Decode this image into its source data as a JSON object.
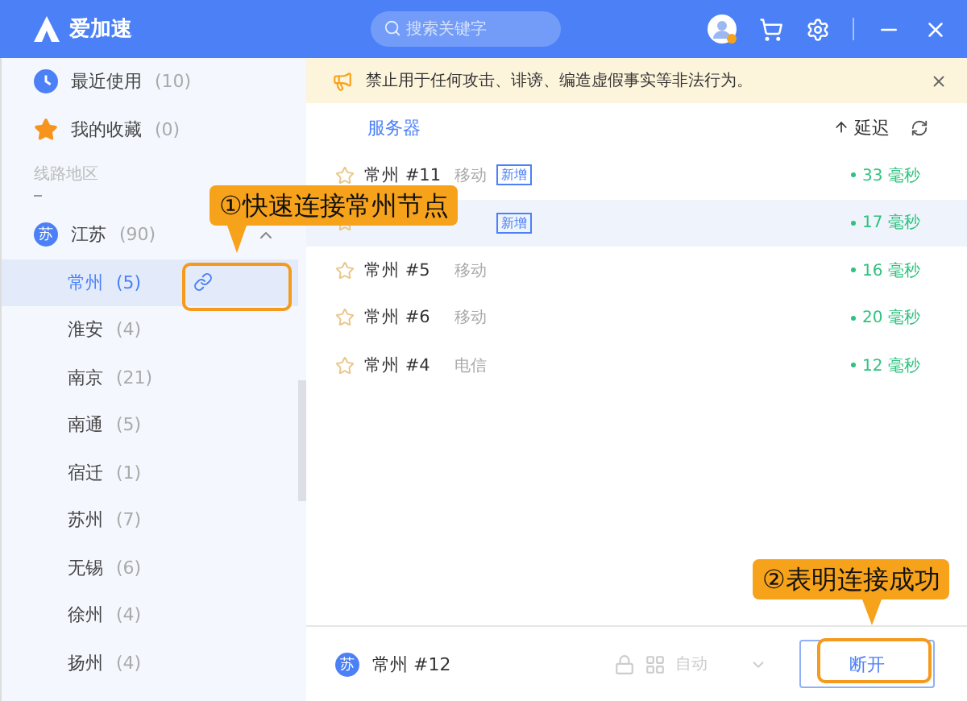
{
  "header": {
    "app_name": "爱加速",
    "search": {
      "placeholder": "搜索关键字"
    }
  },
  "sidebar": {
    "items": [
      {
        "kind": "recent",
        "label": "最近使用",
        "count": "(10)"
      },
      {
        "kind": "favorites",
        "label": "我的收藏",
        "count": "(0)"
      }
    ],
    "section_title": "线路地区",
    "provinces": [
      {
        "badge": "苏",
        "label": "江苏",
        "count": "(90)",
        "expanded": true,
        "children": [
          {
            "label": "常州",
            "count": "(5)",
            "selected": true
          },
          {
            "label": "淮安",
            "count": "(4)",
            "selected": false
          },
          {
            "label": "南京",
            "count": "(21)",
            "selected": false
          },
          {
            "label": "南通",
            "count": "(5)",
            "selected": false
          },
          {
            "label": "宿迁",
            "count": "(1)",
            "selected": false
          },
          {
            "label": "苏州",
            "count": "(7)",
            "selected": false
          },
          {
            "label": "无锡",
            "count": "(6)",
            "selected": false
          },
          {
            "label": "徐州",
            "count": "(4)",
            "selected": false
          },
          {
            "label": "扬州",
            "count": "(4)",
            "selected": false
          }
        ]
      }
    ]
  },
  "notice": {
    "text": "禁止用于任何攻击、诽谤、编造虚假事实等非法行为。"
  },
  "server_list": {
    "columns": [
      "服务器",
      "延迟"
    ],
    "rows": [
      {
        "name": "常州 #11",
        "carrier": "移动",
        "badge": "新增",
        "latency": "33 毫秒",
        "selected": false,
        "favorite": false
      },
      {
        "badge": "新增",
        "latency": "17 毫秒",
        "selected": true,
        "favorite": false
      },
      {
        "name": "常州 #5",
        "carrier": "移动",
        "latency": "16 毫秒",
        "selected": false,
        "favorite": false
      },
      {
        "name": "常州 #6",
        "carrier": "移动",
        "latency": "20 毫秒",
        "selected": false,
        "favorite": false
      },
      {
        "name": "常州 #4",
        "carrier": "电信",
        "latency": "12 毫秒",
        "selected": false,
        "favorite": false
      }
    ]
  },
  "status_bar": {
    "badge": "苏",
    "server": "常州 #12",
    "mode": "自动",
    "button": "断开"
  },
  "annotations": [
    {
      "text": "①快速连接常州节点"
    },
    {
      "text": "②表明连接成功"
    }
  ]
}
